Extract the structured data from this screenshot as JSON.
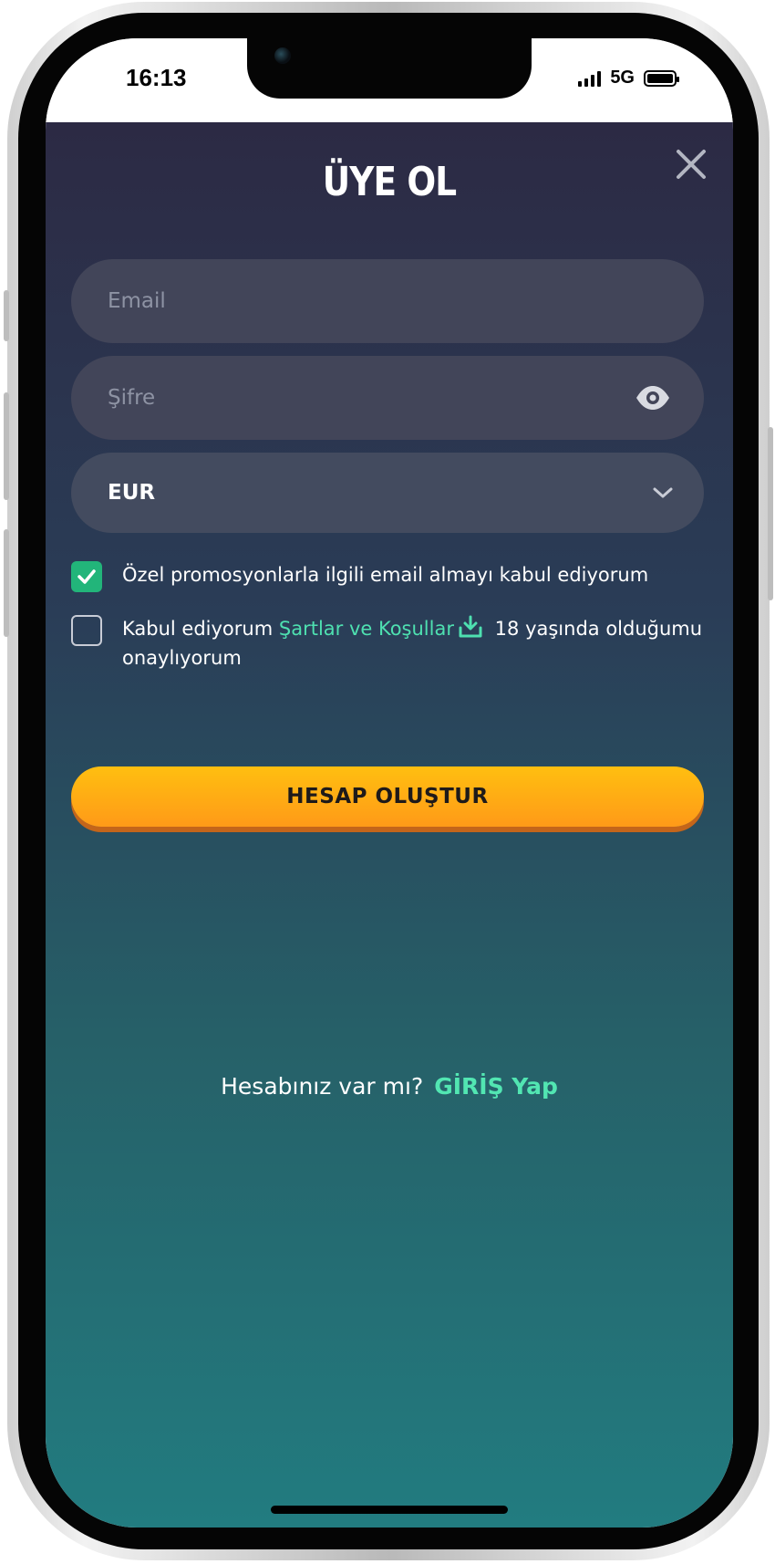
{
  "status_bar": {
    "time": "16:13",
    "network": "5G"
  },
  "signup": {
    "title": "ÜYE OL",
    "email_placeholder": "Email",
    "password_placeholder": "Şifre",
    "currency": "EUR",
    "promo_text": "Özel promosyonlarla ilgili email almayı kabul ediyorum",
    "promo_checked": true,
    "terms_prefix": "Kabul ediyorum",
    "terms_link": "Şartlar ve Koşullar",
    "terms_suffix": "18 yaşında olduğumu onaylıyorum",
    "terms_checked": false,
    "submit_label": "HESAP OLUŞTUR"
  },
  "footer": {
    "question": "Hesabınız var mı?",
    "login_label": "GİRİŞ Yap"
  },
  "colors": {
    "accent": "#4ee0b0",
    "cta_start": "#ffbf10",
    "cta_end": "#ff9a18",
    "checkbox_on": "#22b57a"
  },
  "icons": {
    "close": "close-icon",
    "password_toggle": "eye-icon",
    "dropdown": "chevron-down-icon",
    "download": "download-icon",
    "check": "checkmark-icon"
  }
}
